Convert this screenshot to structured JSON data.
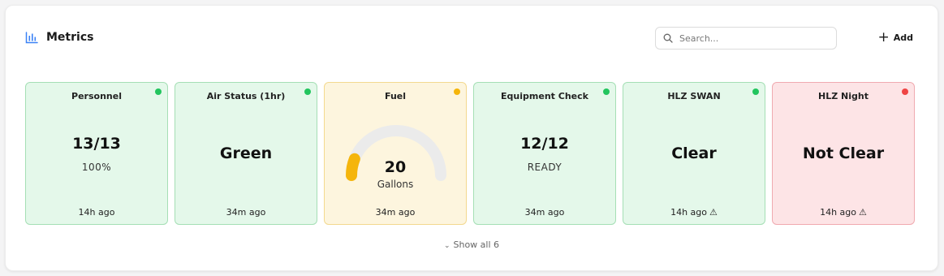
{
  "header": {
    "title": "Metrics",
    "search_placeholder": "Search...",
    "add_label": "Add"
  },
  "cards": [
    {
      "title": "Personnel",
      "value": "13/13",
      "sub": "100%",
      "time": "14h ago",
      "status": "green",
      "warning": false
    },
    {
      "title": "Air Status (1hr)",
      "value": "Green",
      "time": "34m ago",
      "status": "green",
      "warning": false
    },
    {
      "title": "Fuel",
      "gauge_value": "20",
      "gauge_unit": "Gallons",
      "gauge_fraction": 0.12,
      "time": "34m ago",
      "status": "yellow",
      "warning": false
    },
    {
      "title": "Equipment Check",
      "value": "12/12",
      "sub": "READY",
      "time": "34m ago",
      "status": "green",
      "warning": false
    },
    {
      "title": "HLZ SWAN",
      "value": "Clear",
      "time": "14h ago",
      "status": "green",
      "warning": true
    },
    {
      "title": "HLZ Night",
      "value": "Not Clear",
      "time": "14h ago",
      "status": "red",
      "warning": true
    }
  ],
  "footer": {
    "show_all_label": "Show all 6"
  },
  "colors": {
    "status_green": "#22c55e",
    "status_yellow": "#f5b50b",
    "status_red": "#ef4444",
    "accent_blue": "#3b82f6"
  }
}
